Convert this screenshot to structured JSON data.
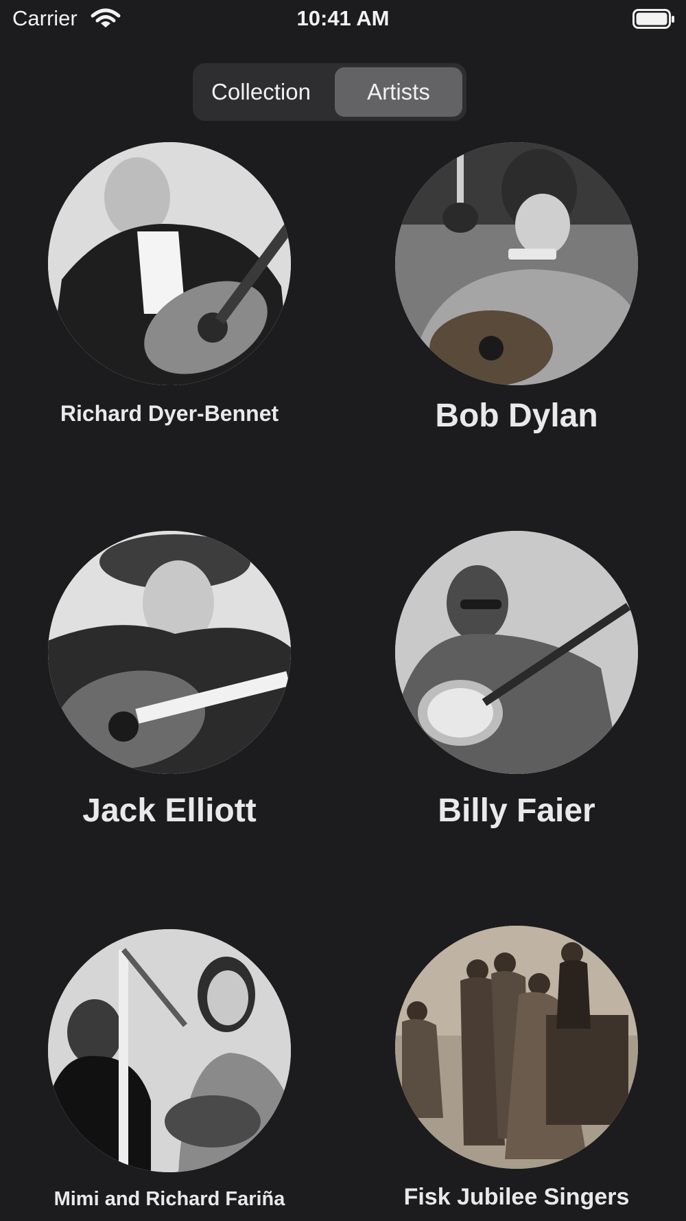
{
  "status_bar": {
    "carrier": "Carrier",
    "time": "10:41 AM",
    "icons": [
      "wifi-icon",
      "battery-icon"
    ]
  },
  "segmented_control": {
    "segments": [
      "Collection",
      "Artists"
    ],
    "selected": "Artists"
  },
  "artists": [
    {
      "name": "Richard Dyer-Bennet"
    },
    {
      "name": "Bob Dylan"
    },
    {
      "name": "Jack Elliott"
    },
    {
      "name": "Billy Faier"
    },
    {
      "name": "Mimi and Richard Fariña"
    },
    {
      "name": "Fisk Jubilee Singers"
    }
  ],
  "colors": {
    "background": "#1c1c1e",
    "segment_track": "#2e2e31",
    "segment_selected": "#636366",
    "text": "#e9e9eb"
  }
}
